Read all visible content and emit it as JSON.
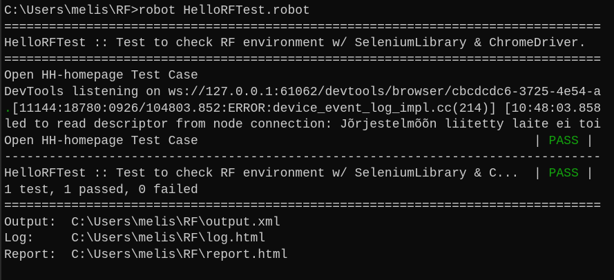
{
  "colors": {
    "background": "#0c0c0c",
    "text": "#cccccc",
    "pass": "#13a10e"
  },
  "terminal": {
    "command_line": "C:\\Users\\melis\\RF>robot HelloRFTest.robot",
    "separator_eq": "================================================================================",
    "suite_header": "HelloRFTest :: Test to check RF environment w/ SeleniumLibrary & ChromeDriver.",
    "test_name_line": "Open HH-homepage Test Case",
    "devtools_line": "DevTools listening on ws://127.0.0.1:61062/devtools/browser/cbcdcdc6-3725-4e54-a",
    "error_dot": ".",
    "error_line": "[11144:18780:0926/104803.852:ERROR:device_event_log_impl.cc(214)] [10:48:03.858",
    "error_line2": "led to read descriptor from node connection: Jõrjestelmõõn liitetty laite ei toi",
    "test_result_name": "Open HH-homepage Test Case                                             ",
    "pipe_open": "| ",
    "pass_label": "PASS",
    "pipe_close": " |",
    "separator_dash": "--------------------------------------------------------------------------------",
    "suite_result_name": "HelloRFTest :: Test to check RF environment w/ SeleniumLibrary & C...  ",
    "summary": "1 test, 1 passed, 0 failed",
    "output_line": "Output:  C:\\Users\\melis\\RF\\output.xml",
    "log_line": "Log:     C:\\Users\\melis\\RF\\log.html",
    "report_line": "Report:  C:\\Users\\melis\\RF\\report.html"
  }
}
